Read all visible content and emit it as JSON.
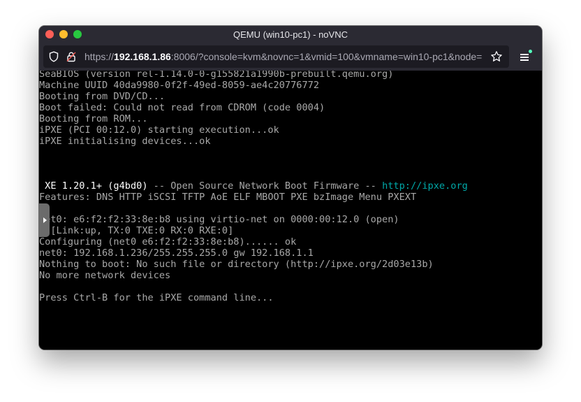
{
  "window": {
    "title": "QEMU (win10-pc1) - noVNC"
  },
  "urlbar": {
    "scheme": "https://",
    "host": "192.168.1.86",
    "rest": ":8006/?console=kvm&novnc=1&vmid=100&vmname=win10-pc1&node="
  },
  "icons": {
    "shield": "shield-icon",
    "lock": "lock-icon",
    "star": "bookmark-star-icon",
    "menu": "hamburger-menu-icon",
    "handle": "sidebar-expand-arrow-icon"
  },
  "colors": {
    "console_text": "#a8a8a8",
    "console_bright": "#ffffff",
    "link": "#00a8a8"
  },
  "console": {
    "lines": [
      "SeaBIOS (version rel-1.14.0-0-g155821a1990b-prebuilt.qemu.org)",
      "Machine UUID 40da9980-0f2f-49ed-8059-ae4c20776772",
      "Booting from DVD/CD...",
      "Boot failed: Could not read from CDROM (code 0004)",
      "Booting from ROM...",
      "iPXE (PCI 00:12.0) starting execution...ok",
      "iPXE initialising devices...ok",
      "",
      "",
      "",
      "",
      "Features: DNS HTTP iSCSI TFTP AoE ELF MBOOT PXE bzImage Menu PXEXT",
      "",
      "net0: e6:f2:f2:33:8e:b8 using virtio-net on 0000:00:12.0 (open)",
      "  [Link:up, TX:0 TXE:0 RX:0 RXE:0]",
      "Configuring (net0 e6:f2:f2:33:8e:b8)...... ok",
      "net0: 192.168.1.236/255.255.255.0 gw 192.168.1.1",
      "Nothing to boot: No such file or directory (http://ipxe.org/2d03e13b)",
      "No more network devices",
      "",
      "Press Ctrl-B for the iPXE command line..."
    ],
    "banner": {
      "version": " XE 1.20.1+ (g4bd0)",
      "middle": " -- Open Source Network Boot Firmware -- ",
      "link": "http://ipxe.org"
    }
  }
}
